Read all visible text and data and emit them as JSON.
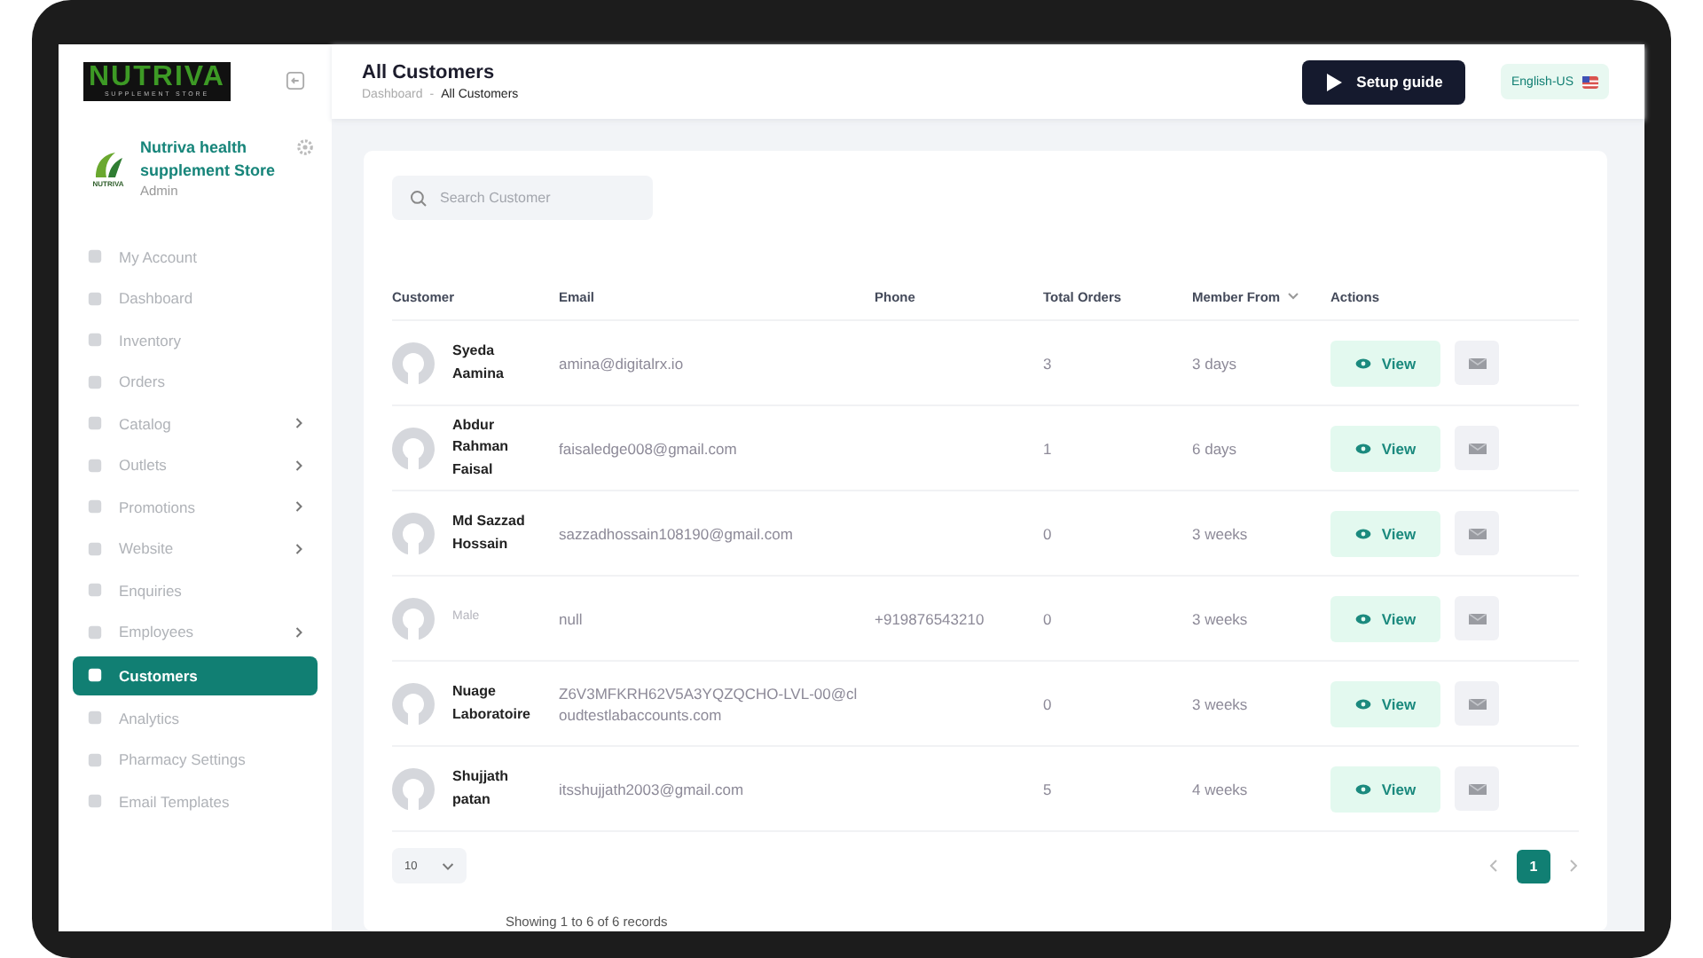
{
  "sidebar": {
    "logo": {
      "title": "NUTRIVA",
      "subtitle": "SUPPLEMENT STORE"
    },
    "store": {
      "logo_text": "NUTRIVA",
      "name": "Nutriva health supplement Store",
      "role": "Admin"
    },
    "items": [
      {
        "label": "My Account",
        "selected": false,
        "expandable": false
      },
      {
        "label": "Dashboard",
        "selected": false,
        "expandable": false
      },
      {
        "label": "Inventory",
        "selected": false,
        "expandable": false
      },
      {
        "label": "Orders",
        "selected": false,
        "expandable": false
      },
      {
        "label": "Catalog",
        "selected": false,
        "expandable": true
      },
      {
        "label": "Outlets",
        "selected": false,
        "expandable": true
      },
      {
        "label": "Promotions",
        "selected": false,
        "expandable": true
      },
      {
        "label": "Website",
        "selected": false,
        "expandable": true
      },
      {
        "label": "Enquiries",
        "selected": false,
        "expandable": false
      },
      {
        "label": "Employees",
        "selected": false,
        "expandable": true
      },
      {
        "label": "Customers",
        "selected": true,
        "expandable": false
      },
      {
        "label": "Analytics",
        "selected": false,
        "expandable": false
      },
      {
        "label": "Pharmacy Settings",
        "selected": false,
        "expandable": false
      },
      {
        "label": "Email Templates",
        "selected": false,
        "expandable": false
      }
    ]
  },
  "header": {
    "title": "All Customers",
    "breadcrumb": [
      "Dashboard",
      "All Customers"
    ],
    "breadcrumb_separator": "-",
    "setup_button": "Setup guide",
    "language": "English-US"
  },
  "search": {
    "placeholder": "Search Customer"
  },
  "table": {
    "columns": [
      "Customer",
      "Email",
      "Phone",
      "Total Orders",
      "Member From",
      "Actions"
    ],
    "rows": [
      {
        "name": "Syeda Aamina",
        "muted": false,
        "email": "amina@digitalrx.io",
        "orders": "3",
        "member_from": "3 days",
        "action": "View"
      },
      {
        "name": "Abdur Rahman Faisal",
        "muted": false,
        "email": "faisaledge008@gmail.com",
        "orders": "1",
        "member_from": "6 days",
        "action": "View"
      },
      {
        "name": "Md Sazzad Hossain",
        "muted": false,
        "email": "sazzadhossain108190@gmail.com",
        "orders": "0",
        "member_from": "3 weeks",
        "action": "View"
      },
      {
        "name": "Male",
        "muted": true,
        "email": "null",
        "phone": "+919876543210",
        "orders": "0",
        "member_from": "3 weeks",
        "action": "View"
      },
      {
        "name": "Nuage Laboratoire",
        "muted": false,
        "email": "Z6V3MFKRH62V5A3YQZQCHO-LVL-00@cloudtestlabaccounts.com",
        "orders": "0",
        "member_from": "3 weeks",
        "action": "View"
      },
      {
        "name": "Shujjath patan",
        "muted": false,
        "email": "itsshujjath2003@gmail.com",
        "orders": "5",
        "member_from": "4 weeks",
        "action": "View"
      }
    ]
  },
  "pagination": {
    "page_size": "10",
    "pages": [
      {
        "label": "1",
        "selected": true
      }
    ],
    "summary": "Showing 1 to 6 of 6 records"
  }
}
